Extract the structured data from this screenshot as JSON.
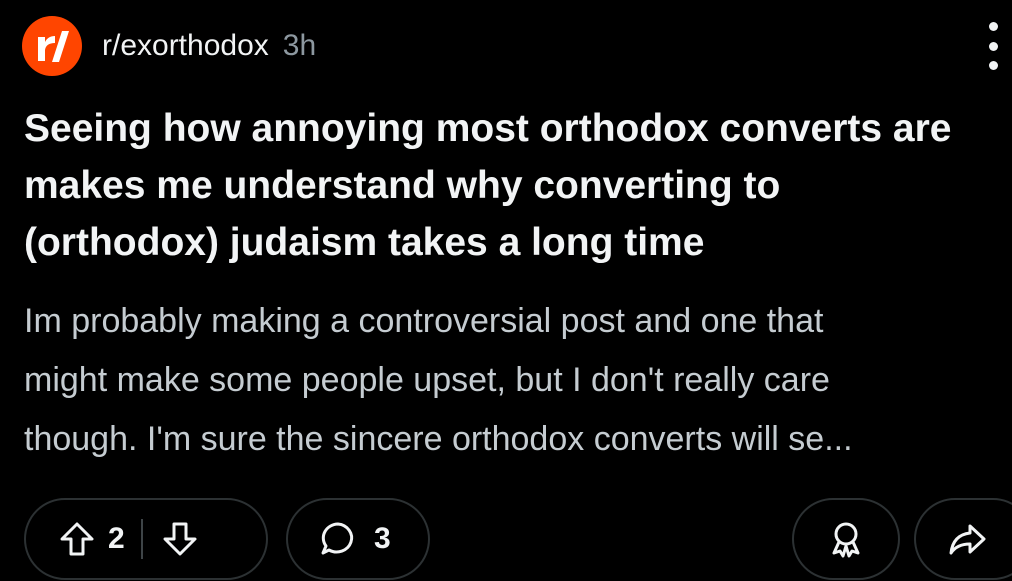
{
  "post": {
    "subreddit": "r/exorthodox",
    "age": "3h",
    "title_lines": [
      "Seeing how annoying most orthodox converts are",
      "makes me understand why converting to",
      "(orthodox) judaism takes a long time"
    ],
    "body_lines": [
      "Im probably making a controversial post and one that",
      "might make some people upset, but I don't really care",
      "though. I'm sure the sincere orthodox converts will se..."
    ]
  },
  "actions": {
    "vote_count": "2",
    "comment_count": "3"
  },
  "icons": {
    "avatar": "reddit-r-slash-logo",
    "menu": "kebab-menu-icon",
    "upvote": "arrow-up-icon",
    "downvote": "arrow-down-icon",
    "comment": "speech-bubble-icon",
    "award": "award-ribbon-icon",
    "share": "share-arrow-icon"
  },
  "colors": {
    "background": "#000000",
    "avatar": "#ff4500",
    "title": "#f2f4f5",
    "body": "#c5ccd1",
    "muted": "#8d98a0",
    "pill_border": "#2c3133"
  }
}
